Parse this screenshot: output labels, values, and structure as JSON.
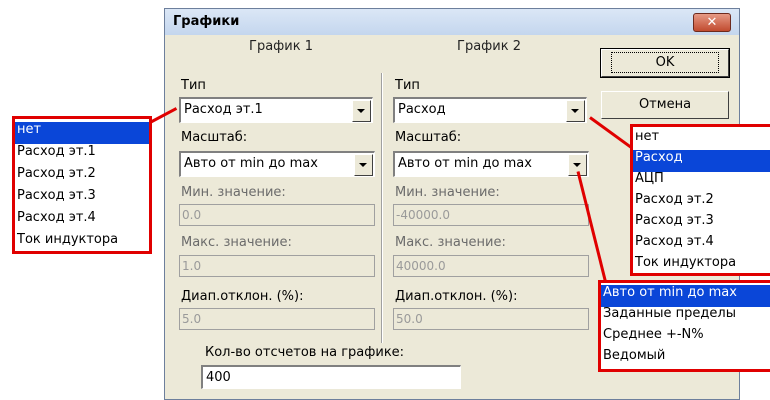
{
  "dialog": {
    "title": "Графики",
    "close_label": "✕",
    "graph1": {
      "header": "График 1",
      "type_label": "Тип",
      "type_value": "Расход эт.1",
      "scale_label": "Масштаб:",
      "scale_value": "Авто от min до max",
      "min_label": "Мин. значение:",
      "min_value": "0.0",
      "max_label": "Макс. значение:",
      "max_value": "1.0",
      "dev_label": "Диап.отклон. (%):",
      "dev_value": "5.0"
    },
    "graph2": {
      "header": "График 2",
      "type_label": "Тип",
      "type_value": "Расход",
      "scale_label": "Масштаб:",
      "scale_value": "Авто от min до max",
      "min_label": "Мин. значение:",
      "min_value": "-40000.0",
      "max_label": "Макс. значение:",
      "max_value": "40000.0",
      "dev_label": "Диап.отклон. (%):",
      "dev_value": "50.0"
    },
    "ok_label": "OK",
    "cancel_label": "Отмена",
    "samples_label": "Кол-во отсчетов на графике:",
    "samples_value": "400"
  },
  "popup_left": {
    "items": [
      "нет",
      "Расход эт.1",
      "Расход эт.2",
      "Расход эт.3",
      "Расход эт.4",
      "Ток индуктора"
    ],
    "selected_index": 0
  },
  "popup_right_type": {
    "items": [
      "нет",
      "Расход",
      "АЦП",
      "Расход эт.2",
      "Расход эт.3",
      "Расход эт.4",
      "Ток индуктора"
    ],
    "selected_index": 1
  },
  "popup_scale": {
    "items": [
      "Авто от min до max",
      "Заданные пределы",
      "Среднее +-N%",
      "Ведомый"
    ],
    "selected_index": 0
  },
  "colors": {
    "highlight": "#0a46d8",
    "annotation": "#e00000"
  }
}
